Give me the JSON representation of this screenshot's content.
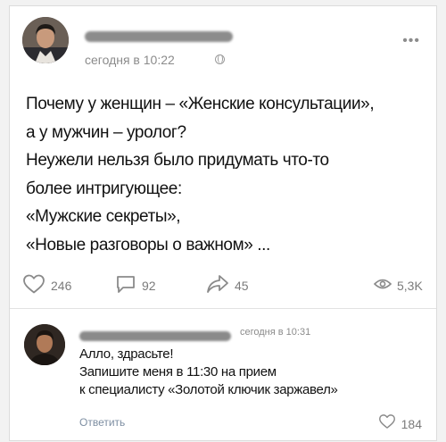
{
  "post": {
    "time": "сегодня в 10:22",
    "lines": [
      "Почему у женщин – «Женские консультации»,",
      "а у мужчин – уролог?",
      "Неужели нельзя было придумать что-то",
      "более интригующее:",
      "«Мужские секреты»,",
      "«Новые разговоры о важном» ..."
    ],
    "likes": "246",
    "comments": "92",
    "shares": "45",
    "views": "5,3K"
  },
  "comment": {
    "time": "сегодня в 10:31",
    "lines": [
      "Алло, здрасьте!",
      "Запишите меня в 11:30 на прием",
      "к специалисту «Золотой ключик заржавел»"
    ],
    "reply_label": "Ответить",
    "likes": "184"
  },
  "icons": {
    "more": "more-icon",
    "globe": "globe-icon",
    "like": "heart-icon",
    "comment": "comment-icon",
    "share": "share-icon",
    "views": "eye-icon"
  },
  "colors": {
    "background": "#f2f2f2",
    "card": "#ffffff",
    "meta_text": "#8b8b8b",
    "reply_link": "#7d8ea2"
  }
}
